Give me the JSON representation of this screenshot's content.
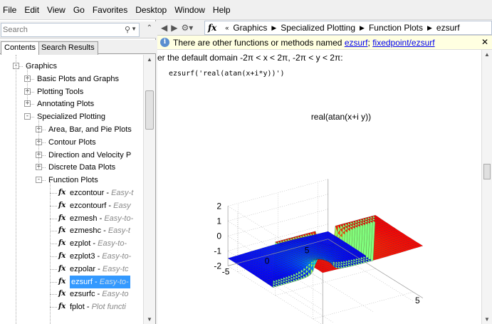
{
  "menu": [
    "File",
    "Edit",
    "View",
    "Go",
    "Favorites",
    "Desktop",
    "Window",
    "Help"
  ],
  "search": {
    "placeholder": "Search"
  },
  "tabs": [
    "Contents",
    "Search Results"
  ],
  "tree": [
    {
      "label": "Graphics",
      "level": 0,
      "expand": "-"
    },
    {
      "label": "Basic Plots and Graphs",
      "level": 1,
      "expand": "+"
    },
    {
      "label": "Plotting Tools",
      "level": 1,
      "expand": "+"
    },
    {
      "label": "Annotating Plots",
      "level": 1,
      "expand": "+"
    },
    {
      "label": "Specialized Plotting",
      "level": 1,
      "expand": "-"
    },
    {
      "label": "Area, Bar, and Pie Plots",
      "level": 2,
      "expand": "+"
    },
    {
      "label": "Contour Plots",
      "level": 2,
      "expand": "+"
    },
    {
      "label": "Direction and Velocity P",
      "level": 2,
      "expand": "+"
    },
    {
      "label": "Discrete Data Plots",
      "level": 2,
      "expand": "+"
    },
    {
      "label": "Function Plots",
      "level": 2,
      "expand": "-"
    },
    {
      "label": "ezcontour",
      "desc": "Easy-t",
      "level": 3,
      "fn": true
    },
    {
      "label": "ezcontourf",
      "desc": "Easy",
      "level": 3,
      "fn": true
    },
    {
      "label": "ezmesh",
      "desc": "Easy-to-",
      "level": 3,
      "fn": true
    },
    {
      "label": "ezmeshc",
      "desc": "Easy-t",
      "level": 3,
      "fn": true
    },
    {
      "label": "ezplot",
      "desc": "Easy-to-",
      "level": 3,
      "fn": true
    },
    {
      "label": "ezplot3",
      "desc": "Easy-to-",
      "level": 3,
      "fn": true
    },
    {
      "label": "ezpolar",
      "desc": "Easy-tc",
      "level": 3,
      "fn": true
    },
    {
      "label": "ezsurf",
      "desc": "Easy-to-",
      "level": 3,
      "fn": true,
      "selected": true
    },
    {
      "label": "ezsurfc",
      "desc": "Easy-to",
      "level": 3,
      "fn": true
    },
    {
      "label": "fplot",
      "desc": "Plot functi",
      "level": 3,
      "fn": true
    }
  ],
  "breadcrumb": [
    "Graphics",
    "Specialized Plotting",
    "Function Plots",
    "ezsurf"
  ],
  "info": {
    "text": "There are other functions or methods named",
    "link1": "ezsurf",
    "sep": ";",
    "link2": "fixedpoint/ezsurf"
  },
  "doc": {
    "domain_text": "er the default domain -2π < x < 2π, -2π < y < 2π:",
    "code": "ezsurf('real(atan(x+i*y))')"
  },
  "chart_data": {
    "type": "surface",
    "title": "real(atan(x+i y))",
    "z_ticks": [
      "2",
      "1",
      "0",
      "-1",
      "-2"
    ],
    "y_ticks": [
      "5",
      "0",
      "-5"
    ],
    "x_ticks": [
      "5"
    ],
    "x_range": [
      -6.28,
      6.28
    ],
    "y_range": [
      -6.28,
      6.28
    ],
    "zlim": [
      -2,
      2
    ],
    "colormap": "jet"
  }
}
